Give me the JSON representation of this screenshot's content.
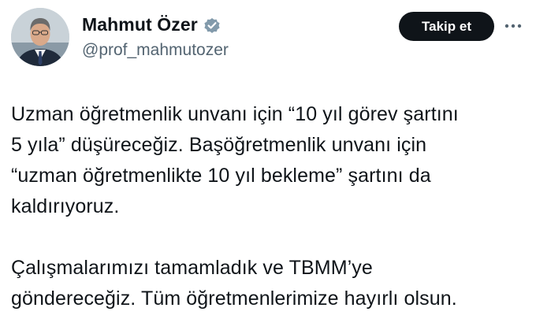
{
  "author": {
    "display_name": "Mahmut Özer",
    "handle": "@prof_mahmutozer",
    "verified": true,
    "verified_color": "#829aab"
  },
  "actions": {
    "follow_label": "Takip et",
    "more_icon": "more-horizontal-icon"
  },
  "tweet": {
    "paragraphs": [
      "Uzman öğretmenlik unvanı için “10 yıl görev şartını\n5 yıla” düşüreceğiz. Başöğretmenlik unvanı için\n“uzman öğretmenlikte 10 yıl bekleme” şartını da\nkaldırıyoruz.",
      "Çalışmalarımızı tamamladık ve TBMM’ye\ngöndereceğiz. Tüm öğretmenlerimize hayırlı olsun."
    ]
  }
}
